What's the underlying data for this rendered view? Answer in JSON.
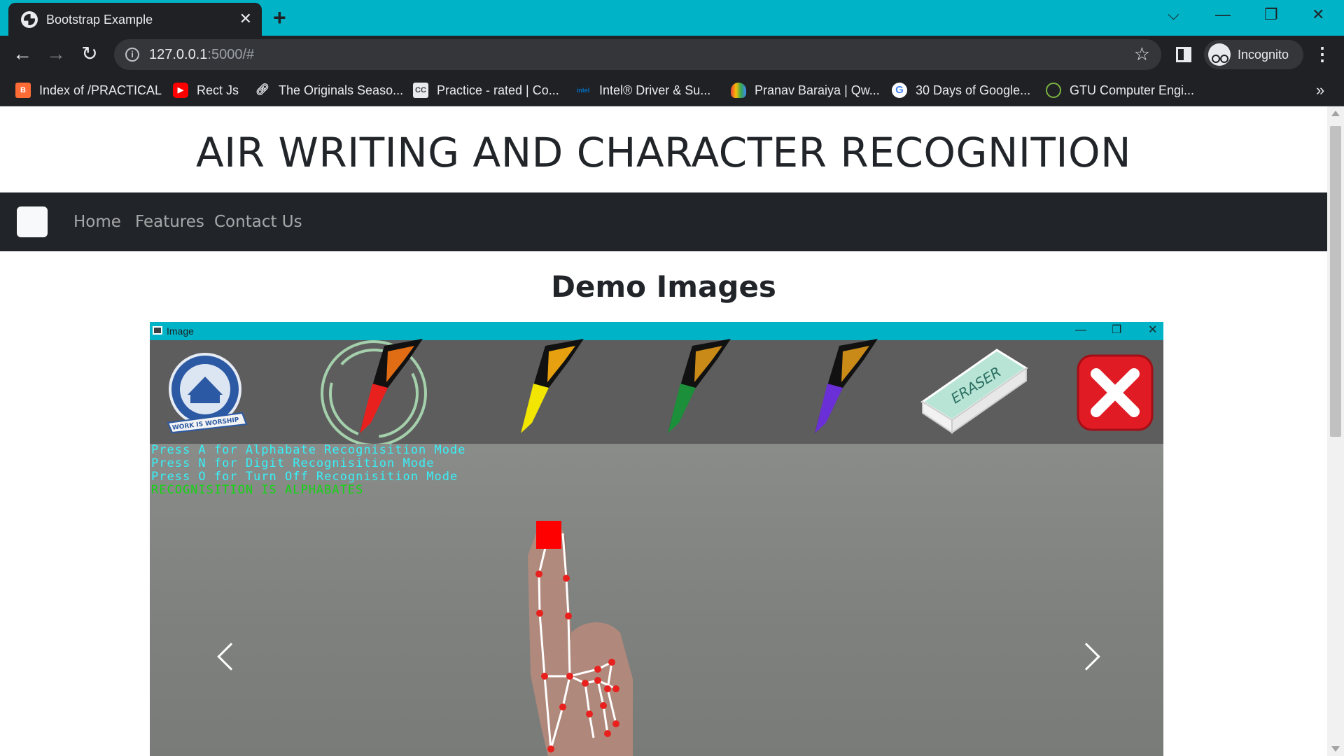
{
  "browser": {
    "tab_title": "Bootstrap Example",
    "tab_close": "✕",
    "new_tab": "+",
    "url_host": "127.0.0.1",
    "url_rest": ":5000/#",
    "incognito_label": "Incognito",
    "window_controls": {
      "dropdown": "⌵",
      "minimize": "—",
      "restore": "❐",
      "close": "✕"
    },
    "bookmarks": [
      {
        "label": "Index of /PRACTICAL",
        "icon": "folder-index-icon",
        "color": "#ff6b35"
      },
      {
        "label": "Rect Js",
        "icon": "youtube-icon",
        "color": "#ff0000"
      },
      {
        "label": "The Originals Seaso...",
        "icon": "link-icon",
        "color": "#9aa0a6"
      },
      {
        "label": "Practice - rated | Co...",
        "icon": "cc-icon",
        "color": "#5a5a5a"
      },
      {
        "label": "Intel® Driver & Su...",
        "icon": "intel-icon",
        "color": "#0071c5"
      },
      {
        "label": "Pranav Baraiya | Qw...",
        "icon": "cloud-icon",
        "color": "#4285f4"
      },
      {
        "label": "30 Days of Google...",
        "icon": "google-icon",
        "color": "#ea4335"
      },
      {
        "label": "GTU Computer Engi...",
        "icon": "gtu-icon",
        "color": "#7cb342"
      }
    ],
    "bookmarks_more": "»"
  },
  "page": {
    "heading": "AIR WRITING AND CHARACTER RECOGNITION",
    "nav": [
      "Home",
      "Features",
      "Contact Us"
    ],
    "section_title": "Demo Images"
  },
  "carousel": {
    "window_title": "Image",
    "window_controls": {
      "minimize": "—",
      "restore": "❐",
      "close": "✕"
    },
    "overlay_lines": [
      "Press A for Alphabate Recognisition Mode",
      "Press N for Digit Recognisition Mode",
      "Press O for Turn Off Recognisition Mode",
      "RECOGNISITION IS ALPHABATES"
    ],
    "logo_text": "WORK IS WORSHIP",
    "eraser_label": "ERASER",
    "tool_colors": {
      "red": "#e8211e",
      "yellow": "#f2e600",
      "green": "#1c8f3a",
      "purple": "#6a2fd6",
      "close": "#e01b24"
    }
  }
}
